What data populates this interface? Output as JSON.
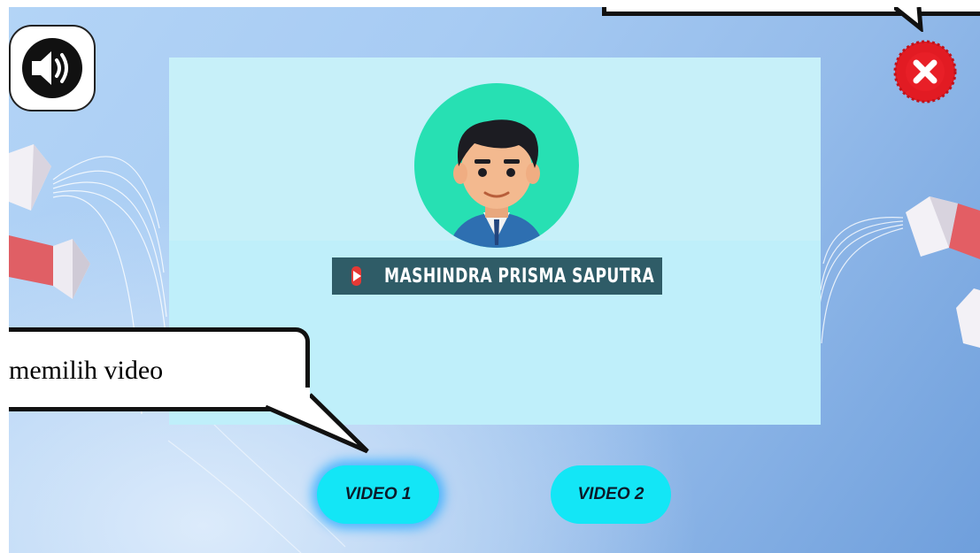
{
  "sound_button": {
    "icon": "speaker-volume-icon"
  },
  "close_button": {
    "icon": "close-x-icon",
    "color": "#e21b23"
  },
  "panel": {
    "channel_name": "MASHINDRA PRISMA SAPUTRA",
    "channel_icon": "youtube-play-icon"
  },
  "video_buttons": [
    {
      "label": "VIDEO 1",
      "highlighted": true
    },
    {
      "label": "VIDEO 2",
      "highlighted": false
    }
  ],
  "callouts": {
    "bottom_text": "memilih video"
  },
  "colors": {
    "background": "#a7cbf3",
    "panel": "#bfeffa",
    "button": "#13e6f6",
    "banner": "#2f5c67",
    "avatar_circle": "#27e0b3"
  }
}
